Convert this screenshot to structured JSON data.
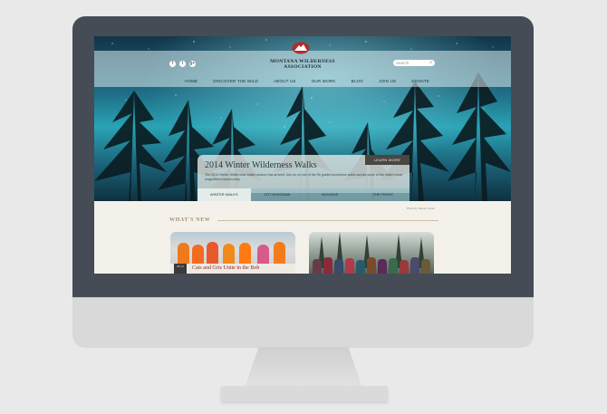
{
  "site": {
    "name_line1": "MONTANA WILDERNESS",
    "name_line2": "ASSOCIATION",
    "search_placeholder": "Search",
    "social": [
      "f",
      "t",
      "g+"
    ],
    "nav": [
      "HOME",
      "DISCOVER THE WILD",
      "ABOUT US",
      "OUR WORK",
      "BLOG",
      "JOIN US",
      "DONATE"
    ]
  },
  "feature": {
    "title": "2014 Winter Wilderness Walks",
    "body": "The 2014 Winter Wilderness Walks season has arrived! Join us on one of the 50 guided snowshoe walks across some of the state's most magnificent backcountry.",
    "learn_more": "LEARN MORE",
    "tabs": [
      "WINTER WALKS",
      "CDT MONTANA",
      "NOXIOUS",
      "THE FRONT"
    ],
    "photo_credit": "Photo by Steven Gnam"
  },
  "whats_new": {
    "label": "WHAT'S NEW",
    "cards": [
      {
        "title": "Cats and Griz Unite in the Bob",
        "date": "05 14"
      },
      {
        "title": ""
      }
    ]
  },
  "colors": {
    "monitor_bezel": "#454c55",
    "accent_gold": "#a3946a",
    "headline_red": "#8a1e1e"
  }
}
